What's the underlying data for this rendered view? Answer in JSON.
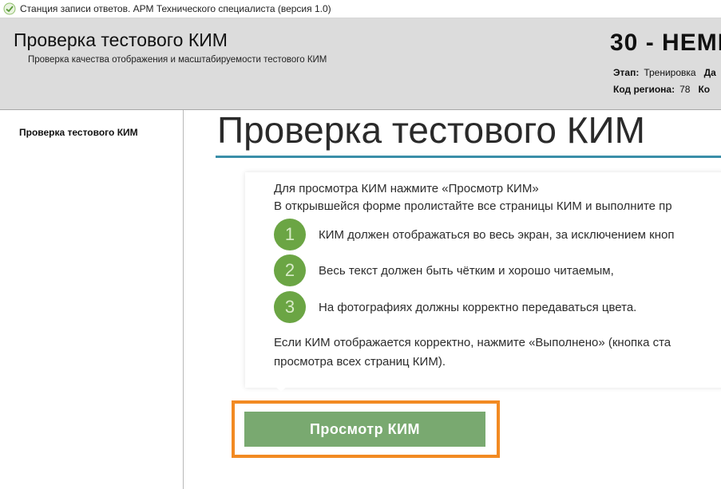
{
  "window": {
    "title": "Станция записи ответов. АРМ Технического специалиста (версия 1.0)",
    "icon": "pen-check-icon"
  },
  "header": {
    "title": "Проверка тестового КИМ",
    "subtitle": "Проверка качества отображения и масштабируемости тестового КИМ",
    "exam_title": "30 - НЕМЕ",
    "stage_label": "Этап:",
    "stage_value": "Тренировка",
    "date_label": "Да",
    "region_label": "Код региона:",
    "region_value": "78",
    "code_label": "Ко"
  },
  "sidebar": {
    "items": [
      {
        "label": "Проверка тестового КИМ"
      }
    ]
  },
  "main": {
    "title": "Проверка тестового КИМ",
    "intro_line1": "Для просмотра КИМ нажмите «Просмотр КИМ»",
    "intro_line2": "В открывшейся форме пролистайте все страницы КИМ и выполните пр",
    "steps": [
      {
        "number": "1",
        "text": "КИМ должен отображаться во весь экран, за исключением кноп"
      },
      {
        "number": "2",
        "text": "Весь текст должен быть чётким и хорошо читаемым,"
      },
      {
        "number": "3",
        "text": "На фотографиях должны корректно передаваться цвета."
      }
    ],
    "outro_line1": "Если КИМ отображается корректно, нажмите «Выполнено» (кнопка ста",
    "outro_line2": "просмотра всех страниц КИМ).",
    "button_label": "Просмотр КИМ"
  },
  "colors": {
    "accent_line": "#3a8ea8",
    "step_circle": "#6ba544",
    "button": "#79a970",
    "highlight": "#f28a22"
  }
}
